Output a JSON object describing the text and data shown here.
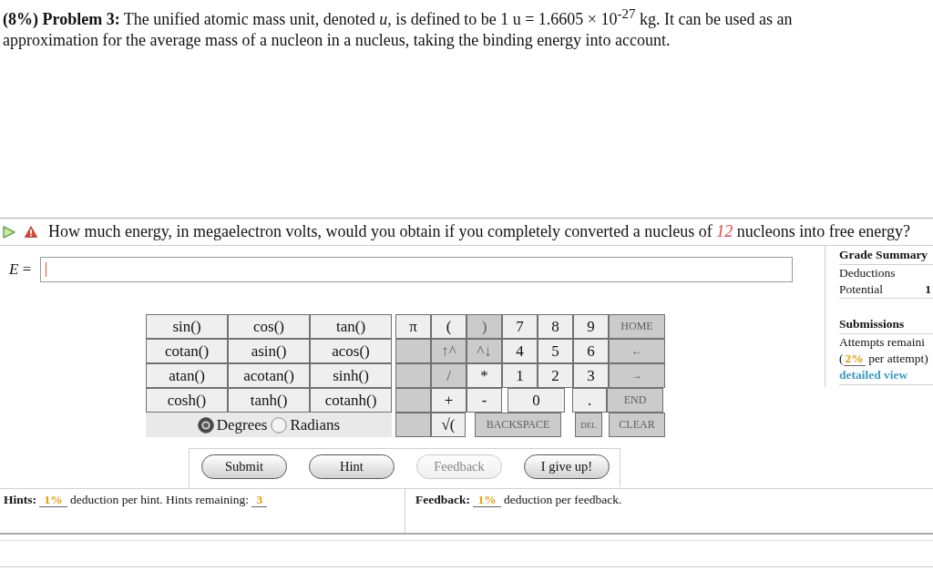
{
  "problem": {
    "text": "**(8%) Problem 3:** The unified atomic mass unit, denoted *u*, is defined to be 1 u = 1.6605 × 10$^{-27}$ kg. It can be used as an approximation for the average mass of a nucleon in a nucleus, taking the binding energy into account."
  },
  "question": {
    "text": "How much energy, in megaelectron volts, would you obtain if you completely converted a nucleus of *12* nucleons into free energy?"
  },
  "answer": {
    "label": "*E* ="
  },
  "grade_summary": {
    "title": "Grade Summary",
    "rows": [
      {
        "label": "Deductions"
      },
      {
        "label": "Potential",
        "value": "1"
      }
    ]
  },
  "submissions": {
    "title": "Submissions",
    "attempts_label": "Attempts remaini",
    "per_attempt": {
      "open": "(",
      "value": "2%",
      "rest": "per attempt)"
    },
    "link": "detailed view"
  },
  "keypad": {
    "functions": [
      [
        "sin()",
        "cos()",
        "tan()"
      ],
      [
        "cotan()",
        "asin()",
        "acos()"
      ],
      [
        "atan()",
        "acotan()",
        "sinh()"
      ],
      [
        "cosh()",
        "tanh()",
        "cotanh()"
      ]
    ],
    "angle_units": [
      {
        "label": "Degrees",
        "selected": true
      },
      {
        "label": "Radians",
        "selected": false
      }
    ],
    "keys": [
      [
        {
          "label": "π",
          "disabled": false
        },
        {
          "label": "(",
          "disabled": false
        },
        {
          "label": ")",
          "disabled": true
        },
        {
          "label": "7",
          "disabled": false
        },
        {
          "label": "8",
          "disabled": false
        },
        {
          "label": "9",
          "disabled": false
        },
        {
          "label": "HOME",
          "disabled": true
        }
      ],
      [
        {
          "disabled": true
        },
        {
          "label": "↑^",
          "disabled": true
        },
        {
          "label": "^↓",
          "disabled": true
        },
        {
          "label": "4",
          "disabled": false
        },
        {
          "label": "5",
          "disabled": false
        },
        {
          "label": "6",
          "disabled": false
        },
        {
          "label": "←",
          "disabled": true
        }
      ],
      [
        {
          "disabled": true
        },
        {
          "label": "/",
          "disabled": true
        },
        {
          "label": "*",
          "disabled": false
        },
        {
          "label": "1",
          "disabled": false
        },
        {
          "label": "2",
          "disabled": false
        },
        {
          "label": "3",
          "disabled": false
        },
        {
          "label": "→",
          "disabled": true
        }
      ],
      [
        {
          "disabled": true
        },
        {
          "label": "+",
          "disabled": false
        },
        {
          "label": "-",
          "disabled": false
        },
        {
          "label": "0",
          "disabled": false
        },
        {
          "label": ".",
          "disabled": false
        },
        {
          "label": "END",
          "disabled": true
        }
      ],
      [
        {
          "disabled": true
        },
        {
          "label": "√(",
          "disabled": false
        },
        {
          "label": "BACKSPACE",
          "disabled": true
        },
        {
          "label": "DEL",
          "disabled": true
        },
        {
          "label": "CLEAR",
          "disabled": true
        }
      ]
    ]
  },
  "buttons": [
    {
      "label": "Submit",
      "disabled": false
    },
    {
      "label": "Hint",
      "disabled": false
    },
    {
      "label": "Feedback",
      "disabled": true
    },
    {
      "label": "I give up!",
      "disabled": false
    }
  ],
  "hints": {
    "label": "Hints:",
    "deduction": "1%",
    "text": "deduction per hint. Hints remaining:",
    "remaining": "3"
  },
  "feedback": {
    "label": "Feedback:",
    "deduction": "1%",
    "text": "deduction per feedback."
  }
}
